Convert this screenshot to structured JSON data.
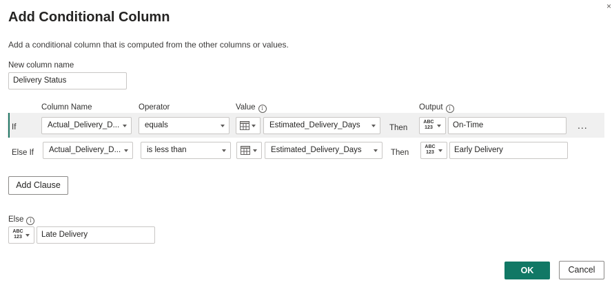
{
  "dialog": {
    "title": "Add Conditional Column",
    "description": "Add a conditional column that is computed from the other columns or values.",
    "new_column_label": "New column name",
    "new_column_value": "Delivery Status"
  },
  "headers": {
    "column_name": "Column Name",
    "operator": "Operator",
    "value": "Value",
    "output": "Output"
  },
  "clauses": [
    {
      "keyword": "If",
      "column": "Actual_Delivery_D...",
      "operator": "equals",
      "value": "Estimated_Delivery_Days",
      "then": "Then",
      "output_type": "ABC 123",
      "output": "On-Time",
      "more": "..."
    },
    {
      "keyword": "Else If",
      "column": "Actual_Delivery_D...",
      "operator": "is less than",
      "value": "Estimated_Delivery_Days",
      "then": "Then",
      "output_type": "ABC 123",
      "output": "Early Delivery"
    }
  ],
  "add_clause_label": "Add Clause",
  "else": {
    "label": "Else",
    "type": "ABC 123",
    "value": "Late Delivery"
  },
  "footer": {
    "ok_label": "OK",
    "cancel_label": "Cancel"
  },
  "colors": {
    "accent": "#117865",
    "row_highlight": "#f0f0f0"
  }
}
